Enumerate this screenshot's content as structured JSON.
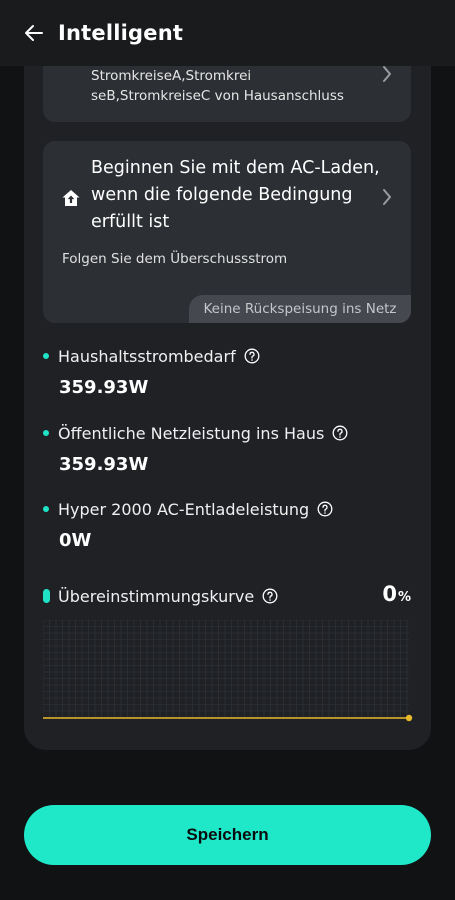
{
  "header": {
    "title": "Intelligent",
    "back_icon": "arrow-left-icon"
  },
  "card_discharge": {
    "text": "StromkreiseA,Stromkrei seB,StromkreiseC von Hausanschluss",
    "chevron_icon": "chevron-right-icon"
  },
  "card_charge": {
    "icon": "home-upload-icon",
    "title": "Beginnen Sie mit dem AC-Laden, wenn die folgende Bedingung erfüllt ist",
    "subtitle": "Folgen Sie dem Überschussstrom",
    "badge": "Keine Rückspeisung ins Netz",
    "chevron_icon": "chevron-right-icon"
  },
  "metrics": [
    {
      "label": "Haushaltsstrombedarf",
      "value": "359.93W"
    },
    {
      "label": "Öffentliche Netzleistung ins Haus",
      "value": "359.93W"
    },
    {
      "label": "Hyper 2000 AC-Entladeleistung",
      "value": "0W"
    }
  ],
  "curve": {
    "label": "Übereinstimmungskurve",
    "value": "0",
    "unit": "%"
  },
  "chart_data": {
    "type": "line",
    "series": [
      {
        "values": [
          0,
          0
        ]
      }
    ],
    "grid": true,
    "line_color": "#e8b92a"
  },
  "save_label": "Speichern",
  "colors": {
    "accent": "#1fe8c8",
    "background": "#111214",
    "panel": "#1f2125",
    "card": "#2c2f34"
  }
}
